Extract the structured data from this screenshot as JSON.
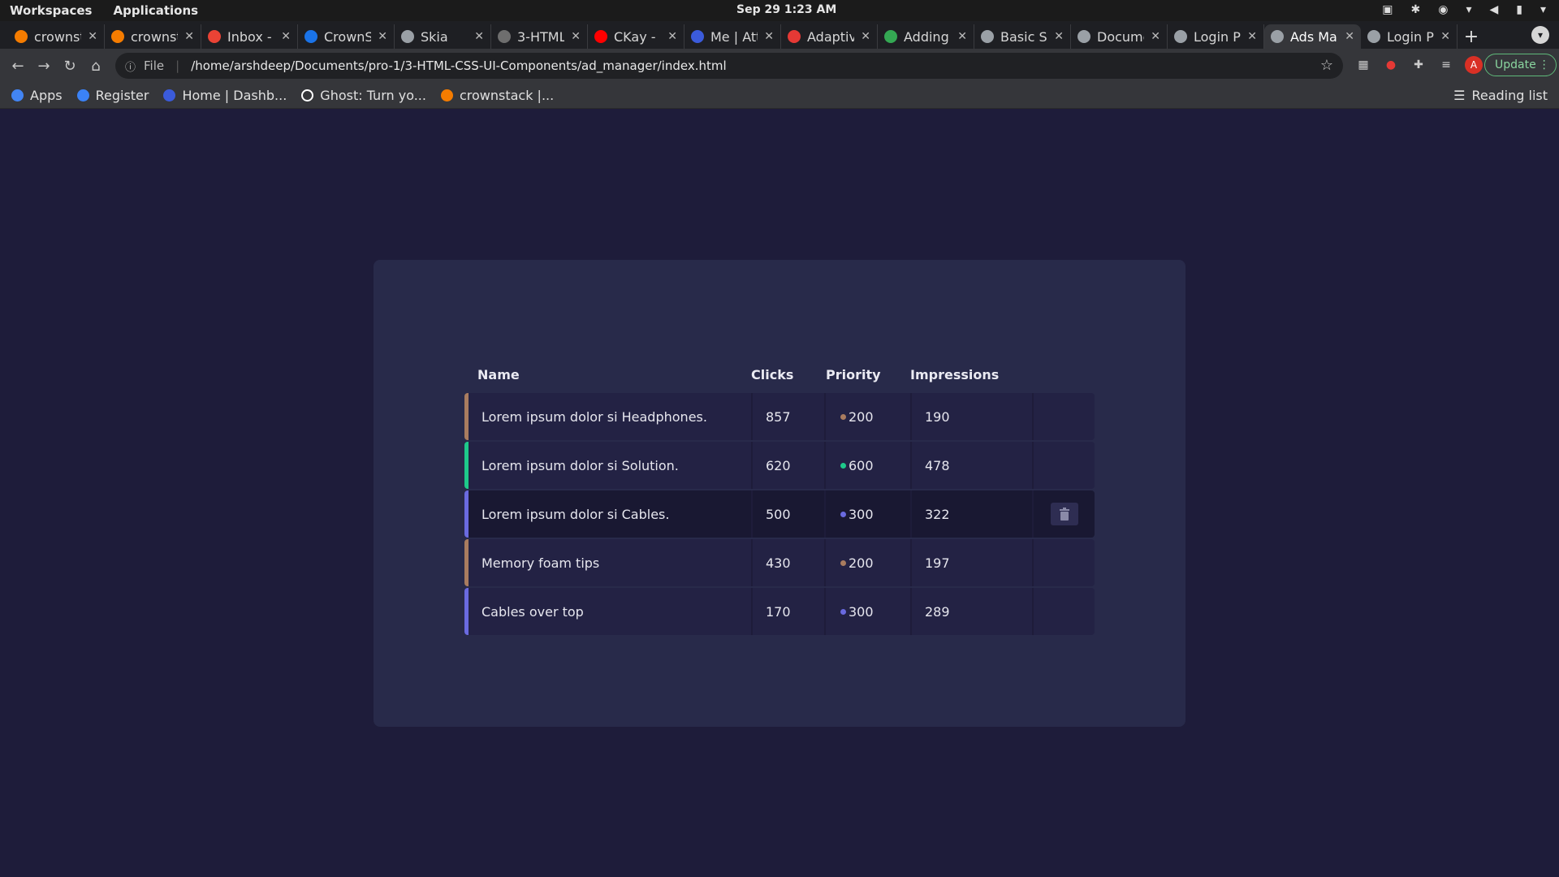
{
  "system_bar": {
    "workspaces": "Workspaces",
    "applications": "Applications",
    "clock": "Sep 29  1:23 AM"
  },
  "tabs": [
    {
      "title": "crownst",
      "icon": "crownstack-icon",
      "color": "#f57c00"
    },
    {
      "title": "crownst",
      "icon": "crownstack-icon",
      "color": "#f57c00"
    },
    {
      "title": "Inbox -",
      "icon": "gmail-icon",
      "color": "#ea4335"
    },
    {
      "title": "CrownS",
      "icon": "calendar-icon",
      "color": "#1a73e8"
    },
    {
      "title": "Skia",
      "icon": "globe-icon",
      "color": "#9aa0a6"
    },
    {
      "title": "3-HTML",
      "icon": "github-icon",
      "color": "#6e6e6e"
    },
    {
      "title": "CKay - L",
      "icon": "youtube-icon",
      "color": "#ff0000"
    },
    {
      "title": "Me | Att",
      "icon": "k-icon",
      "color": "#3b5bdb"
    },
    {
      "title": "Adaptiv",
      "icon": "asterisk-icon",
      "color": "#e53935"
    },
    {
      "title": "Adding",
      "icon": "globe-color-icon",
      "color": "#34a853"
    },
    {
      "title": "Basic S",
      "icon": "keyboard-icon",
      "color": "#9aa0a6"
    },
    {
      "title": "Docume",
      "icon": "globe-icon",
      "color": "#9aa0a6"
    },
    {
      "title": "Login P",
      "icon": "globe-icon",
      "color": "#9aa0a6"
    },
    {
      "title": "Ads Ma",
      "icon": "globe-icon",
      "color": "#9aa0a6",
      "active": true
    },
    {
      "title": "Login P",
      "icon": "globe-icon",
      "color": "#9aa0a6"
    }
  ],
  "toolbar": {
    "scheme": "File",
    "url": "/home/arshdeep/Documents/pro-1/3-HTML-CSS-UI-Components/ad_manager/index.html",
    "update_label": "Update",
    "avatar_letter": "A"
  },
  "bookmarks": {
    "items": [
      {
        "label": "Apps",
        "icon": "apps-grid-icon",
        "color": "#4285f4"
      },
      {
        "label": "Register",
        "icon": "k-icon",
        "color": "#3b82f6"
      },
      {
        "label": "Home | Dashb...",
        "icon": "k-icon",
        "color": "#3b5bdb"
      },
      {
        "label": "Ghost: Turn yo...",
        "icon": "ghost-icon",
        "color": "#ffffff"
      },
      {
        "label": "crownstack |...",
        "icon": "crownstack-icon",
        "color": "#f57c00"
      }
    ],
    "reading_list": "Reading list"
  },
  "ad_table": {
    "headers": {
      "name": "Name",
      "clicks": "Clicks",
      "priority": "Priority",
      "impressions": "Impressions"
    },
    "rows": [
      {
        "name": "Lorem ipsum dolor si Headphones.",
        "clicks": "857",
        "priority": "200",
        "impressions": "190",
        "accent": "#a97c5f"
      },
      {
        "name": "Lorem ipsum dolor si Solution.",
        "clicks": "620",
        "priority": "600",
        "impressions": "478",
        "accent": "#1ec98a"
      },
      {
        "name": "Lorem ipsum dolor si Cables.",
        "clicks": "500",
        "priority": "300",
        "impressions": "322",
        "accent": "#6a6ae0",
        "hovered": true
      },
      {
        "name": "Memory foam tips",
        "clicks": "430",
        "priority": "200",
        "impressions": "197",
        "accent": "#a97c5f"
      },
      {
        "name": "Cables over top",
        "clicks": "170",
        "priority": "300",
        "impressions": "289",
        "accent": "#6a6ae0"
      }
    ]
  },
  "colors": {
    "page_bg": "#1e1c3a",
    "card_bg": "#282a4a",
    "row_bg": "#232244",
    "row_hover_bg": "#191832"
  }
}
